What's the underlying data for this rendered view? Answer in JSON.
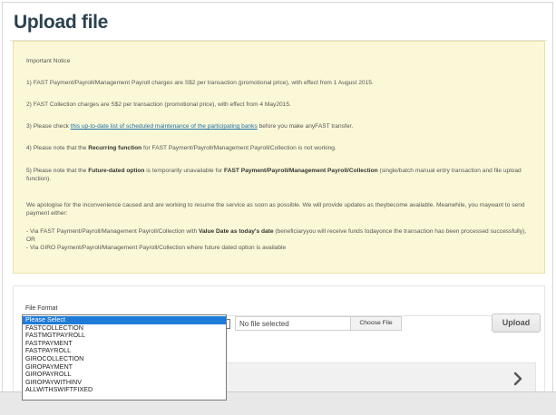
{
  "page": {
    "title": "Upload file"
  },
  "notice": {
    "heading": "Important Notice",
    "p1": "1) FAST Payment/Payroll/Management Payroll charges are S$2 per transaction (promotional price), with effect from 1 August 2015.",
    "p2": "2) FAST Collection charges are S$2 per transaction (promotional price), with effect from 4 May2015.",
    "p3_before": "3) Please check ",
    "p3_link": "this up-to-date list of scheduled maintenance of the participating banks",
    "p3_after": " before you make anyFAST transfer.",
    "p4_before": "4) Please note that the ",
    "p4_bold": "Recurring function",
    "p4_after": " for FAST Payment/Payroll/Management Payroll/Collection is not working.",
    "p5_before": "5) Please note that the ",
    "p5_bold1": "Future-dated option",
    "p5_mid": " is temporarily unavailable for ",
    "p5_bold2": "FAST Payment/Payroll/Management Payroll/Collection",
    "p5_after": " (single/batch manual entry transaction and file upload function).",
    "p6": "We apologise for the inconvenience caused and are working to resume the service as soon as possible. We will provide updates as theybecome available. Meanwhile, you maywant to send payment either:",
    "p7_before": "-  Via FAST Payment/Payroll/Management Payroll/Collection with ",
    "p7_bold": "Value Date as today's date",
    "p7_after": " (beneficiaryyou will receive funds todayonce the transaction has been processed successfully), OR",
    "p8": "-  Via GIRO Payment/Payroll/Management Payroll/Collection where future dated option is available"
  },
  "form": {
    "file_format_label": "File Format",
    "selected_option": "Please Select",
    "options": [
      "Please Select",
      "FASTCOLLECTION",
      "FASTMGTPAYROLL",
      "FASTPAYMENT",
      "FASTPAYROLL",
      "GIROCOLLECTION",
      "GIROPAYMENT",
      "GIROPAYROLL",
      "GIROPAYWITHINV",
      "ALLWITHSWIFTFIXED"
    ],
    "file_status": "No file selected",
    "choose_file_label": "Choose File",
    "upload_label": "Upload"
  },
  "colors": {
    "title": "#2b4250",
    "notice_bg": "#fbf8d7",
    "link": "#1a6fa8",
    "selected_option_bg": "#1e7bd8"
  },
  "icons": {
    "accordion": "chevron-right-icon"
  }
}
